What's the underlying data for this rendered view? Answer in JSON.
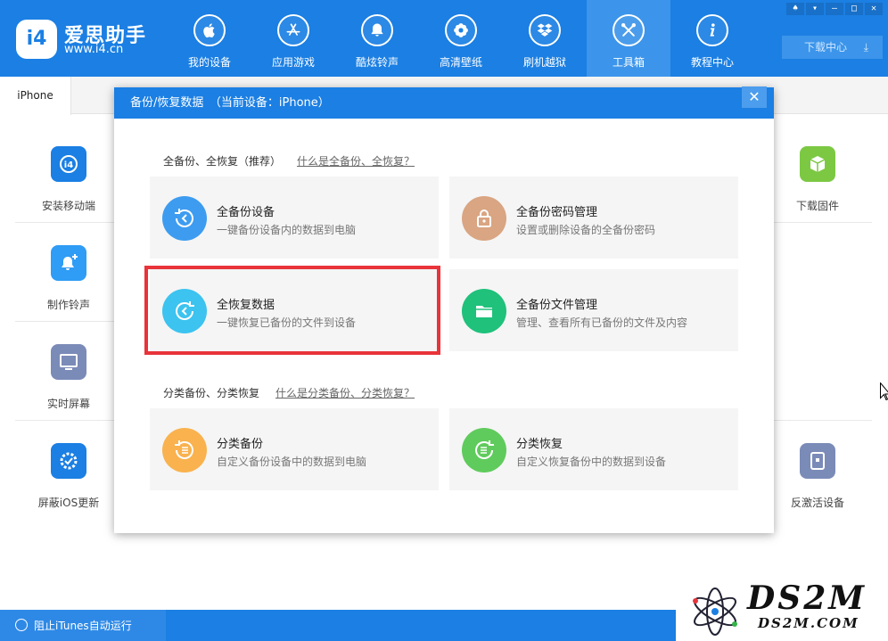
{
  "app": {
    "name": "爱思助手",
    "url": "www.i4.cn",
    "logo_text": "i4"
  },
  "nav": [
    {
      "label": "我的设备",
      "icon": "apple-icon"
    },
    {
      "label": "应用游戏",
      "icon": "app-store-icon"
    },
    {
      "label": "酷炫铃声",
      "icon": "bell-icon"
    },
    {
      "label": "高清壁纸",
      "icon": "flower-icon"
    },
    {
      "label": "刷机越狱",
      "icon": "dropbox-icon"
    },
    {
      "label": "工具箱",
      "icon": "tools-icon",
      "active": true
    },
    {
      "label": "教程中心",
      "icon": "info-icon"
    }
  ],
  "window_controls": [
    "shirt-icon",
    "menu-icon",
    "minimize-icon",
    "maximize-icon",
    "close-icon"
  ],
  "download_center": "下载中心",
  "device_tab": "iPhone",
  "tools_left": [
    "安装移动端",
    "制作铃声",
    "实时屏幕",
    "屏蔽iOS更新"
  ],
  "tools_right": [
    "下载固件",
    "反激活设备"
  ],
  "status": {
    "text": "阻止iTunes自动运行"
  },
  "dialog": {
    "title": "备份/恢复数据　（当前设备：iPhone）",
    "close": "✕",
    "section1": {
      "title": "全备份、全恢复（推荐）",
      "link": "什么是全备份、全恢复？"
    },
    "section2": {
      "title": "分类备份、分类恢复",
      "link": "什么是分类备份、分类恢复？"
    },
    "cards": [
      {
        "title": "全备份设备",
        "desc": "一键备份设备内的数据到电脑",
        "color": "#3d9cf0"
      },
      {
        "title": "全备份密码管理",
        "desc": "设置或删除设备的全备份密码",
        "color": "#d9a582"
      },
      {
        "title": "全恢复数据",
        "desc": "一键恢复已备份的文件到设备",
        "color": "#3cc3ef"
      },
      {
        "title": "全备份文件管理",
        "desc": "管理、查看所有已备份的文件及内容",
        "color": "#1fc17b"
      },
      {
        "title": "分类备份",
        "desc": "自定义备份设备中的数据到电脑",
        "color": "#f9b24e"
      },
      {
        "title": "分类恢复",
        "desc": "自定义恢复备份中的数据到设备",
        "color": "#5fcb5c"
      }
    ]
  },
  "watermark": {
    "title": "DS2M",
    "sub": "DS2M.COM"
  },
  "colors": {
    "brand": "#1b7fe3",
    "highlight": "#e8343a"
  }
}
